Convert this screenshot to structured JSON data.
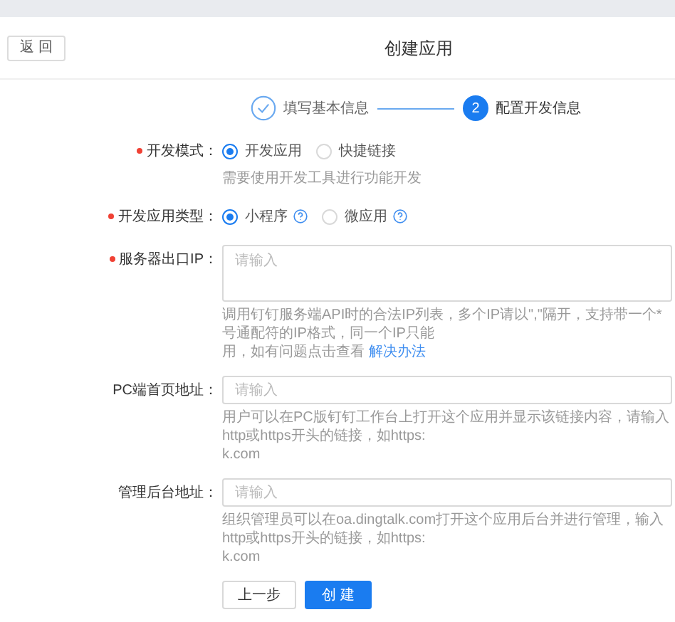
{
  "back_button": "返 回",
  "title": "创建应用",
  "steps": [
    {
      "label": "填写基本信息",
      "done": true,
      "current": false
    },
    {
      "label": "配置开发信息",
      "done": false,
      "current": true,
      "number": "2"
    }
  ],
  "fields": [
    {
      "kind": "radio",
      "label": "开发模式：",
      "required": true,
      "options": [
        {
          "label": "开发应用",
          "selected": true,
          "help": false
        },
        {
          "label": "快捷链接",
          "selected": false,
          "help": false
        }
      ],
      "hint": [
        {
          "text": "需要使用开发工具进行功能开发"
        }
      ]
    },
    {
      "kind": "radio",
      "label": "开发应用类型：",
      "required": true,
      "options": [
        {
          "label": "小程序",
          "selected": true,
          "help": true
        },
        {
          "label": "微应用",
          "selected": false,
          "help": true
        }
      ]
    },
    {
      "kind": "textarea",
      "label": "服务器出口IP：",
      "required": true,
      "placeholder": "请输入",
      "hint": [
        {
          "text": "调用钉钉服务端API时的合法IP列表，多个IP请以\",\"隔开，支持带一个*号通配符的IP格式，同一个IP只能"
        },
        {
          "text": "用，如有问题点击查看",
          "link": "解决办法"
        }
      ]
    },
    {
      "kind": "input",
      "label": "PC端首页地址：",
      "required": false,
      "placeholder": "请输入",
      "hint": [
        {
          "text": "用户可以在PC版钉钉工作台上打开这个应用并显示该链接内容，请输入http或https开头的链接，如https:"
        },
        {
          "text": "k.com"
        }
      ]
    },
    {
      "kind": "input",
      "label": "管理后台地址：",
      "required": false,
      "placeholder": "请输入",
      "hint": [
        {
          "text": "组织管理员可以在oa.dingtalk.com打开这个应用后台并进行管理，输入http或https开头的链接，如https:"
        },
        {
          "text": "k.com"
        }
      ]
    }
  ],
  "buttons": [
    {
      "label": "上一步",
      "primary": false
    },
    {
      "label": "创 建",
      "primary": true
    }
  ]
}
